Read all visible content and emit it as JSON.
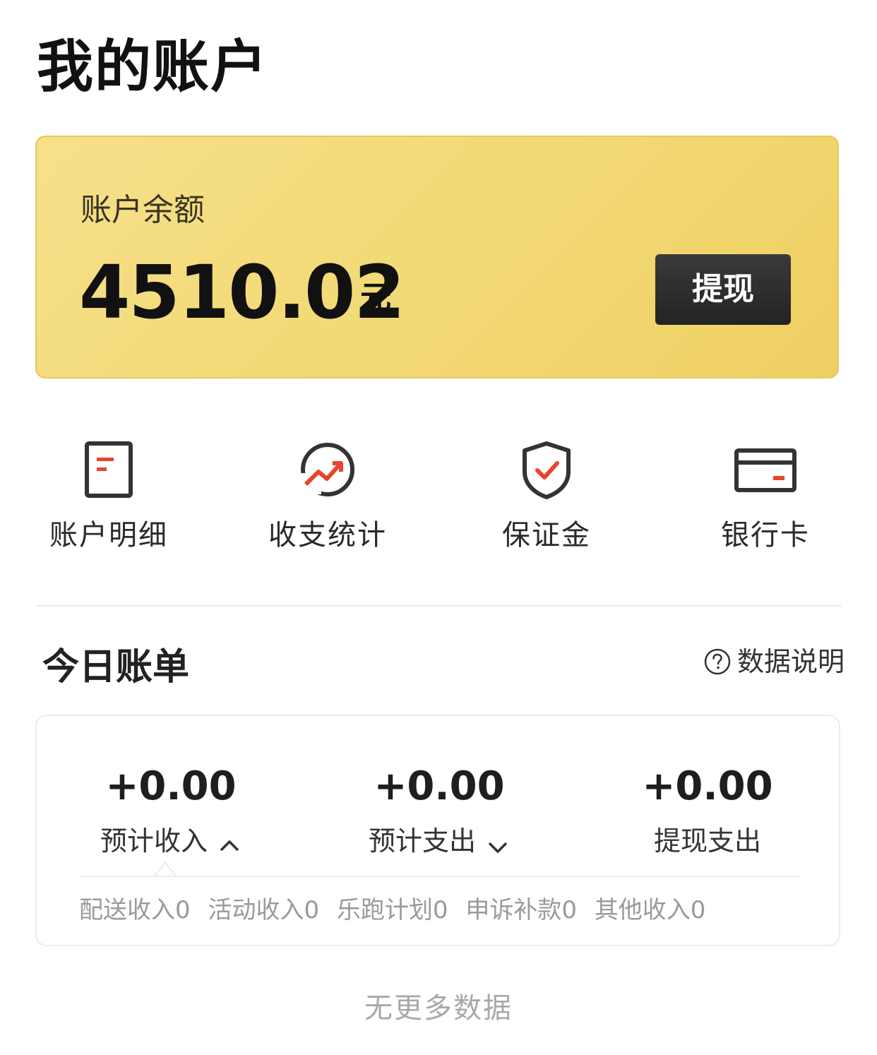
{
  "header": {
    "title": "我的账户"
  },
  "balance": {
    "label": "账户余额",
    "amount": "4510.02",
    "unit": "元",
    "withdraw_label": "提现"
  },
  "shortcuts": [
    {
      "label": "账户明细",
      "icon": "document-icon"
    },
    {
      "label": "收支统计",
      "icon": "trend-chart-icon"
    },
    {
      "label": "保证金",
      "icon": "shield-check-icon"
    },
    {
      "label": "银行卡",
      "icon": "bank-card-icon"
    }
  ],
  "today_bill": {
    "title": "今日账单",
    "help_label": "数据说明",
    "stats": [
      {
        "value": "+0.00",
        "label": "预计收入",
        "chevron": "up"
      },
      {
        "value": "+0.00",
        "label": "预计支出",
        "chevron": "down"
      },
      {
        "value": "+0.00",
        "label": "提现支出",
        "chevron": ""
      }
    ],
    "breakdown": [
      "配送收入0",
      "活动收入0",
      "乐跑计划0",
      "申诉补款0",
      "其他收入0"
    ]
  },
  "footer": {
    "no_more": "无更多数据"
  },
  "colors": {
    "card_gold": "#f3da78",
    "button_dark": "#2a2a2a",
    "icon_dark": "#333333",
    "accent_red": "#e8442e"
  }
}
